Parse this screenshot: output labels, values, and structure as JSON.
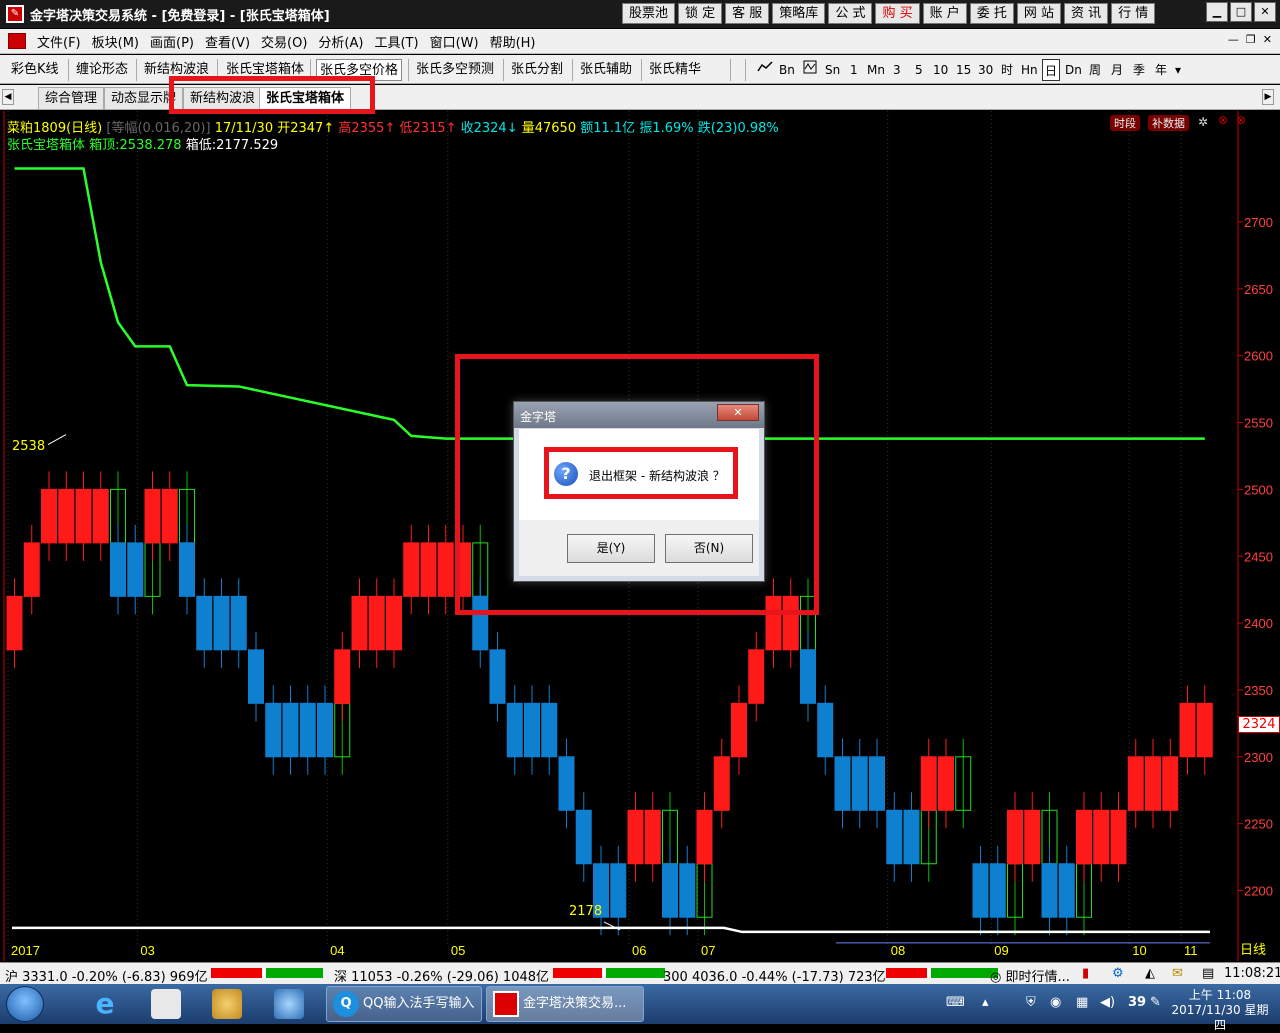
{
  "window": {
    "title": "金字塔决策交易系统 - [免费登录] - [张氏宝塔箱体]"
  },
  "quick_buttons": [
    "股票池",
    "锁 定",
    "客 服",
    "策略库",
    "公 式",
    "购 买",
    "账 户",
    "委 托",
    "网 站",
    "资 讯",
    "行 情"
  ],
  "menu": [
    "文件(F)",
    "板块(M)",
    "画面(P)",
    "查看(V)",
    "交易(O)",
    "分析(A)",
    "工具(T)",
    "窗口(W)",
    "帮助(H)"
  ],
  "toolbar": [
    "彩色K线",
    "缠论形态",
    "新结构波浪",
    "张氏宝塔箱体",
    "张氏多空价格",
    "张氏多空预测",
    "张氏分割",
    "张氏辅助",
    "张氏精华"
  ],
  "timeframes": [
    "Bn",
    "Sn",
    "1",
    "Mn",
    "3",
    "5",
    "10",
    "15",
    "30",
    "时",
    "Hn",
    "日",
    "Dn",
    "周",
    "月",
    "季",
    "年"
  ],
  "tabs": [
    "综合管理",
    "动态显示牌",
    "新结构波浪",
    "张氏宝塔箱体"
  ],
  "chart": {
    "header": "菜粕1809(日线)",
    "scale_note": "[等幅(0.016,20)]",
    "date": "17/11/30",
    "open": "开2347↑",
    "high": "高2355↑",
    "low": "低2315↑",
    "close": "收2324↓",
    "volume": "量47650",
    "amount": "额11.1亿",
    "amplitude": "振1.69%",
    "change": "跌(23)0.98%",
    "indicator_name": "张氏宝塔箱体",
    "box_top": "箱顶:2538.278",
    "box_bottom": "箱低:2177.529",
    "btn_period": "时段",
    "btn_supplement": "补数据",
    "price_axis": [
      "2700",
      "2650",
      "2600",
      "2550",
      "2500",
      "2450",
      "2400",
      "2350",
      "2300",
      "2250",
      "2200"
    ],
    "current_price": "2324",
    "label_high": "2538",
    "label_low": "2178",
    "months": [
      "2017",
      "03",
      "04",
      "05",
      "06",
      "07",
      "08",
      "09",
      "10",
      "11"
    ],
    "axis_unit": "日线",
    "color_up": "#ff1a1a",
    "color_down": "#0f7fd0",
    "color_box": "#2bff2b"
  },
  "chart_data": {
    "type": "candlestick",
    "ylim": [
      2180,
      2740
    ],
    "box_top_line": [
      [
        0,
        2740
      ],
      [
        4,
        2740
      ],
      [
        5,
        2670
      ],
      [
        6,
        2625
      ],
      [
        7,
        2607
      ],
      [
        9,
        2607
      ],
      [
        10,
        2578
      ],
      [
        13,
        2577
      ],
      [
        22,
        2552
      ],
      [
        23,
        2540
      ],
      [
        25,
        2538
      ],
      [
        69,
        2538
      ]
    ],
    "bottom_line_value": 2178,
    "bricks": [
      [
        0,
        2420,
        2380,
        -1
      ],
      [
        1,
        2460,
        2420,
        -1
      ],
      [
        2,
        2500,
        2460,
        -1
      ],
      [
        3,
        2500,
        2460,
        -1
      ],
      [
        4,
        2500,
        2460,
        -1
      ],
      [
        5,
        2500,
        2460,
        -1
      ],
      [
        6,
        2500,
        2460,
        0
      ],
      [
        6,
        2460,
        2420,
        1
      ],
      [
        7,
        2460,
        2420,
        1
      ],
      [
        8,
        2460,
        2420,
        0
      ],
      [
        8,
        2500,
        2460,
        -1
      ],
      [
        9,
        2500,
        2460,
        -1
      ],
      [
        10,
        2500,
        2460,
        0
      ],
      [
        10,
        2460,
        2420,
        1
      ],
      [
        11,
        2420,
        2380,
        1
      ],
      [
        12,
        2420,
        2380,
        1
      ],
      [
        13,
        2420,
        2380,
        1
      ],
      [
        14,
        2380,
        2340,
        1
      ],
      [
        15,
        2340,
        2300,
        1
      ],
      [
        16,
        2340,
        2300,
        1
      ],
      [
        17,
        2340,
        2300,
        1
      ],
      [
        18,
        2340,
        2300,
        1
      ],
      [
        19,
        2340,
        2300,
        0
      ],
      [
        19,
        2380,
        2340,
        -1
      ],
      [
        20,
        2420,
        2380,
        -1
      ],
      [
        21,
        2420,
        2380,
        -1
      ],
      [
        22,
        2420,
        2380,
        -1
      ],
      [
        23,
        2460,
        2420,
        -1
      ],
      [
        24,
        2460,
        2420,
        -1
      ],
      [
        25,
        2460,
        2420,
        -1
      ],
      [
        26,
        2460,
        2420,
        -1
      ],
      [
        27,
        2460,
        2420,
        0
      ],
      [
        27,
        2420,
        2380,
        1
      ],
      [
        28,
        2380,
        2340,
        1
      ],
      [
        29,
        2340,
        2300,
        1
      ],
      [
        30,
        2340,
        2300,
        1
      ],
      [
        31,
        2340,
        2300,
        1
      ],
      [
        32,
        2300,
        2260,
        1
      ],
      [
        33,
        2260,
        2220,
        1
      ],
      [
        34,
        2220,
        2180,
        1
      ],
      [
        35,
        2220,
        2180,
        1
      ],
      [
        36,
        2260,
        2220,
        -1
      ],
      [
        37,
        2260,
        2220,
        -1
      ],
      [
        38,
        2260,
        2220,
        0
      ],
      [
        38,
        2220,
        2180,
        1
      ],
      [
        39,
        2220,
        2180,
        1
      ],
      [
        40,
        2220,
        2180,
        0
      ],
      [
        40,
        2260,
        2220,
        -1
      ],
      [
        41,
        2300,
        2260,
        -1
      ],
      [
        42,
        2340,
        2300,
        -1
      ],
      [
        43,
        2380,
        2340,
        -1
      ],
      [
        44,
        2420,
        2380,
        -1
      ],
      [
        45,
        2420,
        2380,
        -1
      ],
      [
        46,
        2420,
        2380,
        0
      ],
      [
        46,
        2380,
        2340,
        1
      ],
      [
        47,
        2340,
        2300,
        1
      ],
      [
        48,
        2300,
        2260,
        1
      ],
      [
        49,
        2300,
        2260,
        1
      ],
      [
        50,
        2300,
        2260,
        1
      ],
      [
        51,
        2260,
        2220,
        1
      ],
      [
        52,
        2260,
        2220,
        1
      ],
      [
        53,
        2260,
        2220,
        0
      ],
      [
        53,
        2300,
        2260,
        -1
      ],
      [
        54,
        2300,
        2260,
        -1
      ],
      [
        55,
        2300,
        2260,
        0
      ],
      [
        56,
        2220,
        2180,
        1
      ],
      [
        57,
        2220,
        2180,
        1
      ],
      [
        58,
        2220,
        2180,
        0
      ],
      [
        58,
        2260,
        2220,
        -1
      ],
      [
        59,
        2260,
        2220,
        -1
      ],
      [
        60,
        2260,
        2220,
        0
      ],
      [
        60,
        2220,
        2180,
        1
      ],
      [
        61,
        2220,
        2180,
        1
      ],
      [
        62,
        2220,
        2180,
        0
      ],
      [
        62,
        2260,
        2220,
        -1
      ],
      [
        63,
        2260,
        2220,
        -1
      ],
      [
        64,
        2260,
        2220,
        -1
      ],
      [
        65,
        2300,
        2260,
        -1
      ],
      [
        66,
        2300,
        2260,
        -1
      ],
      [
        67,
        2300,
        2260,
        -1
      ],
      [
        68,
        2340,
        2300,
        -1
      ],
      [
        69,
        2340,
        2300,
        -1
      ]
    ]
  },
  "dialog": {
    "title": "金字塔",
    "close": "✕",
    "message": "退出框架 - 新结构波浪 ？",
    "yes": "是(Y)",
    "no": "否(N)"
  },
  "statusbar": {
    "sh": "沪 3331.0 -0.20% (-6.83) 969亿",
    "sz": "深 11053 -0.26% (-29.06) 1048亿",
    "idx300": "300 4036.0 -0.44% (-17.73) 723亿",
    "realtime": "即时行情...",
    "time": "11:08:21"
  },
  "taskbar": {
    "task1": "QQ输入法手写输入",
    "task2": "金字塔决策交易...",
    "tray_num": "39",
    "clock_time": "上午 11:08",
    "clock_date": "2017/11/30 星期四"
  }
}
